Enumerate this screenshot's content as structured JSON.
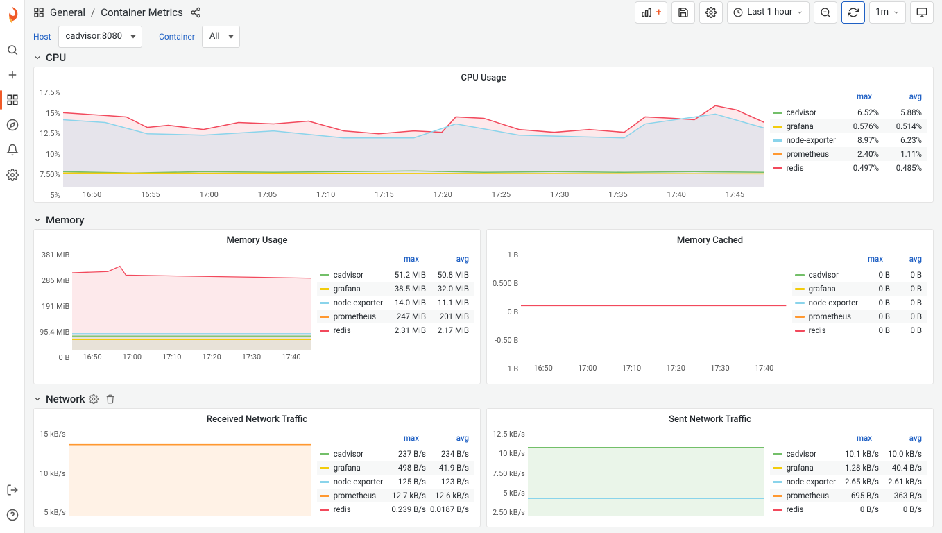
{
  "breadcrumb": {
    "icon": "dashboards",
    "folder": "General",
    "dashboard": "Container Metrics"
  },
  "timepicker": {
    "label": "Last 1 hour",
    "refresh": "1m"
  },
  "variables": {
    "host_label": "Host",
    "host_value": "cadvisor:8080",
    "container_label": "Container",
    "container_value": "All"
  },
  "rows": {
    "cpu": "CPU",
    "memory": "Memory",
    "network": "Network"
  },
  "series_colors": {
    "cadvisor": "#73bf69",
    "grafana": "#f2cc0c",
    "node-exporter": "#8ad4eb",
    "prometheus": "#ff9830",
    "redis": "#f2495c"
  },
  "chart_data": [
    {
      "id": "cpu_usage",
      "title": "CPU Usage",
      "type": "area",
      "x_ticks": [
        "16:50",
        "16:55",
        "17:00",
        "17:05",
        "17:10",
        "17:15",
        "17:20",
        "17:25",
        "17:30",
        "17:35",
        "17:40",
        "17:45"
      ],
      "y_ticks": [
        "5%",
        "7.50%",
        "10%",
        "12.5%",
        "15%",
        "17.5%"
      ],
      "ylim": [
        5,
        17.5
      ],
      "legend_cols": [
        "max",
        "avg"
      ],
      "series": [
        {
          "name": "cadvisor",
          "max": "6.52%",
          "avg": "5.88%"
        },
        {
          "name": "grafana",
          "max": "0.576%",
          "avg": "0.514%"
        },
        {
          "name": "node-exporter",
          "max": "8.97%",
          "avg": "6.23%"
        },
        {
          "name": "prometheus",
          "max": "2.40%",
          "avg": "1.11%"
        },
        {
          "name": "redis",
          "max": "0.497%",
          "avg": "0.485%"
        }
      ]
    },
    {
      "id": "memory_usage",
      "title": "Memory Usage",
      "type": "area",
      "x_ticks": [
        "16:50",
        "17:00",
        "17:10",
        "17:20",
        "17:30",
        "17:40"
      ],
      "y_ticks": [
        "0 B",
        "95.4 MiB",
        "191 MiB",
        "286 MiB",
        "381 MiB"
      ],
      "ylim": [
        0,
        381
      ],
      "legend_cols": [
        "max",
        "avg"
      ],
      "series": [
        {
          "name": "cadvisor",
          "max": "51.2 MiB",
          "avg": "50.8 MiB"
        },
        {
          "name": "grafana",
          "max": "38.5 MiB",
          "avg": "32.0 MiB"
        },
        {
          "name": "node-exporter",
          "max": "14.0 MiB",
          "avg": "11.1 MiB"
        },
        {
          "name": "prometheus",
          "max": "247 MiB",
          "avg": "201 MiB"
        },
        {
          "name": "redis",
          "max": "2.31 MiB",
          "avg": "2.17 MiB"
        }
      ]
    },
    {
      "id": "memory_cached",
      "title": "Memory Cached",
      "type": "line",
      "x_ticks": [
        "16:50",
        "17:00",
        "17:10",
        "17:20",
        "17:30",
        "17:40"
      ],
      "y_ticks": [
        "-1 B",
        "-0.50 B",
        "0 B",
        "0.500 B",
        "1 B"
      ],
      "ylim": [
        -1,
        1
      ],
      "legend_cols": [
        "max",
        "avg"
      ],
      "series": [
        {
          "name": "cadvisor",
          "max": "0 B",
          "avg": "0 B"
        },
        {
          "name": "grafana",
          "max": "0 B",
          "avg": "0 B"
        },
        {
          "name": "node-exporter",
          "max": "0 B",
          "avg": "0 B"
        },
        {
          "name": "prometheus",
          "max": "0 B",
          "avg": "0 B"
        },
        {
          "name": "redis",
          "max": "0 B",
          "avg": "0 B"
        }
      ]
    },
    {
      "id": "rx",
      "title": "Received Network Traffic",
      "type": "area",
      "x_ticks": [],
      "y_ticks": [
        "5 kB/s",
        "10 kB/s",
        "15 kB/s"
      ],
      "ylim": [
        0,
        15
      ],
      "legend_cols": [
        "max",
        "avg"
      ],
      "series": [
        {
          "name": "cadvisor",
          "max": "237 B/s",
          "avg": "234 B/s"
        },
        {
          "name": "grafana",
          "max": "498 B/s",
          "avg": "41.9 B/s"
        },
        {
          "name": "node-exporter",
          "max": "125 B/s",
          "avg": "123 B/s"
        },
        {
          "name": "prometheus",
          "max": "12.7 kB/s",
          "avg": "12.6 kB/s"
        },
        {
          "name": "redis",
          "max": "0.239 B/s",
          "avg": "0.0187 B/s"
        }
      ]
    },
    {
      "id": "tx",
      "title": "Sent Network Traffic",
      "type": "area",
      "x_ticks": [],
      "y_ticks": [
        "2.50 kB/s",
        "5 kB/s",
        "7.50 kB/s",
        "10 kB/s",
        "12.5 kB/s"
      ],
      "ylim": [
        0,
        12.5
      ],
      "legend_cols": [
        "max",
        "avg"
      ],
      "series": [
        {
          "name": "cadvisor",
          "max": "10.1 kB/s",
          "avg": "10.0 kB/s"
        },
        {
          "name": "grafana",
          "max": "1.28 kB/s",
          "avg": "40.4 B/s"
        },
        {
          "name": "node-exporter",
          "max": "2.65 kB/s",
          "avg": "2.61 kB/s"
        },
        {
          "name": "prometheus",
          "max": "695 B/s",
          "avg": "363 B/s"
        },
        {
          "name": "redis",
          "max": "0 B/s",
          "avg": "0 B/s"
        }
      ]
    }
  ]
}
